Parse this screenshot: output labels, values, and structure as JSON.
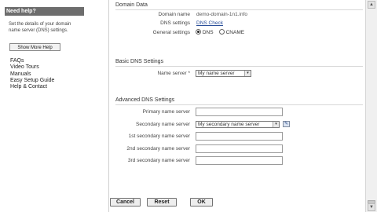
{
  "sidebar": {
    "header": "Need help?",
    "description": "Set the details of your domain name server (DNS) settings.",
    "show_more_label": "Show More Help",
    "links": [
      "FAQs",
      "Video Tours",
      "Manuals",
      "Easy Setup Guide",
      "Help & Contact"
    ]
  },
  "domain_data": {
    "title": "Domain Data",
    "domain_name_label": "Domain name",
    "domain_name_value": "demo-domain-1n1.info",
    "dns_settings_label": "DNS settings",
    "dns_check_link": "DNS Check",
    "general_settings_label": "General settings",
    "radio_dns": "DNS",
    "radio_cname": "CNAME"
  },
  "basic_dns": {
    "title": "Basic DNS Settings",
    "name_server_label": "Name server *",
    "name_server_value": "My name server"
  },
  "advanced_dns": {
    "title": "Advanced DNS Settings",
    "primary_label": "Primary name server",
    "secondary_label": "Secondary name server",
    "secondary_value": "My secondary name server",
    "first_secondary_label": "1st secondary name server",
    "second_secondary_label": "2nd secondary name server",
    "third_secondary_label": "3rd secondary name server"
  },
  "buttons": {
    "cancel": "Cancel",
    "reset": "Reset",
    "ok": "OK"
  },
  "scrollbar": {
    "up_arrow": "▲",
    "down_arrow": "▼"
  },
  "icons": {
    "select_arrow": "▾",
    "edit": "✎"
  }
}
